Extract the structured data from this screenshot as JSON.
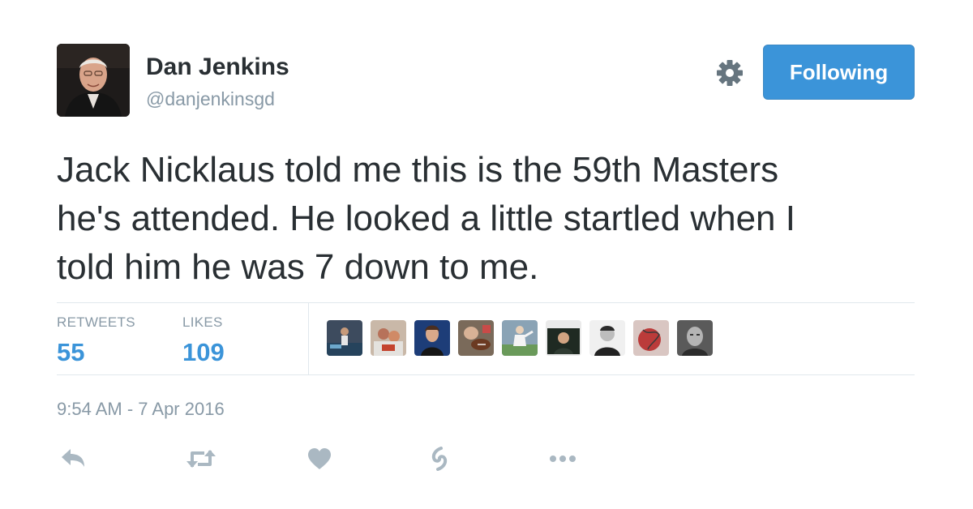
{
  "user": {
    "display_name": "Dan Jenkins",
    "screen_name": "@danjenkinsgd"
  },
  "follow_button": {
    "label": "Following",
    "color": "#3b94d9"
  },
  "tweet": {
    "text": "Jack Nicklaus told me this is the 59th Masters\nhe's attended. He looked a little startled when I\ntold him he was 7 down to me.",
    "timestamp": "9:54 AM - 7 Apr 2016"
  },
  "stats": {
    "retweets_label": "RETWEETS",
    "retweets_count": "55",
    "likes_label": "LIKES",
    "likes_count": "109"
  },
  "likers_count_shown": 9,
  "actions": [
    {
      "icon": "reply-icon"
    },
    {
      "icon": "retweet-icon"
    },
    {
      "icon": "like-heart-icon"
    },
    {
      "icon": "vine-icon"
    },
    {
      "icon": "more-dots-icon"
    }
  ],
  "colors": {
    "text": "#292f33",
    "muted": "#8899a6",
    "accent": "#3b94d9",
    "divider": "#e1e8ed",
    "action_icon": "#aab8c2"
  }
}
